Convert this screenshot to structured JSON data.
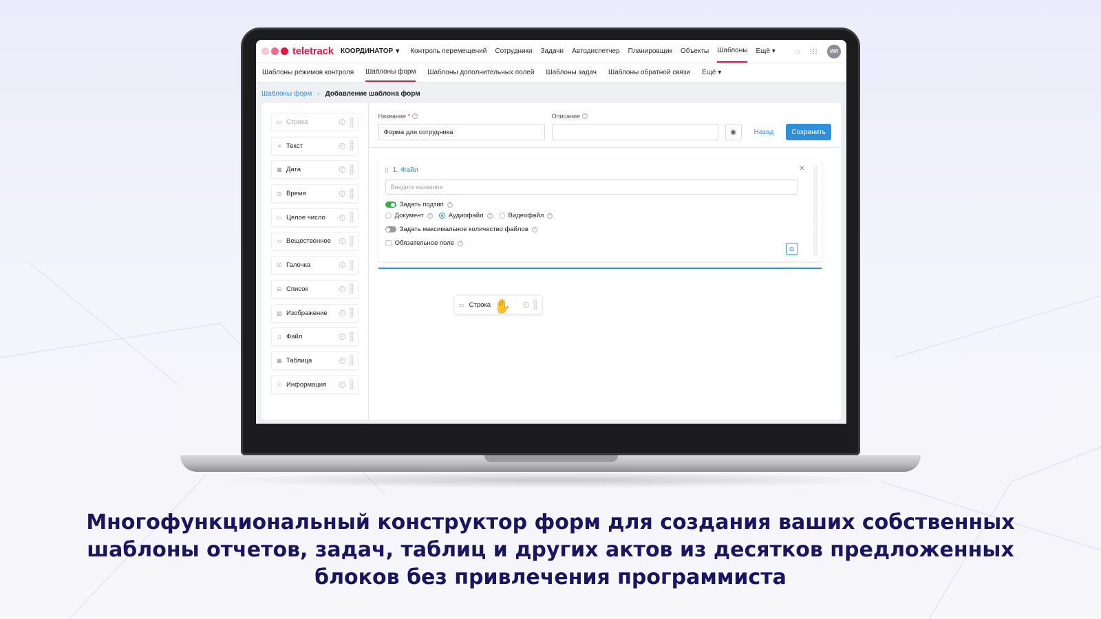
{
  "app": {
    "brand": "teletrack",
    "coordinator": "КООРДИНАТОР",
    "nav": [
      "Контроль перемещений",
      "Сотрудники",
      "Задачи",
      "Автодиспетчер",
      "Планировщик",
      "Объекты",
      "Шаблоны",
      "Ещё"
    ],
    "nav_active": "Шаблоны",
    "avatar": "ИИ",
    "colors": {
      "brand": "#e0193f",
      "accent": "#2f8fdc",
      "toggle_on": "#2fb34a"
    }
  },
  "subnav": [
    "Шаблоны режимов контроля",
    "Шаблоны форм",
    "Шаблоны дополнительных полей",
    "Шаблоны задач",
    "Шаблоны обратной связи",
    "Ещё"
  ],
  "breadcrumb": {
    "link": "Шаблоны форм",
    "current": "Добавление шаблона форм"
  },
  "palette": [
    {
      "label": "Строка",
      "icon": "string-icon"
    },
    {
      "label": "Текст",
      "icon": "text-icon"
    },
    {
      "label": "Дата",
      "icon": "calendar-icon"
    },
    {
      "label": "Время",
      "icon": "clock-icon"
    },
    {
      "label": "Целое число",
      "icon": "integer-icon"
    },
    {
      "label": "Вещественное",
      "icon": "decimal-icon"
    },
    {
      "label": "Галочка",
      "icon": "checkbox-icon"
    },
    {
      "label": "Список",
      "icon": "list-icon"
    },
    {
      "label": "Изображение",
      "icon": "image-icon"
    },
    {
      "label": "Файл",
      "icon": "file-icon"
    },
    {
      "label": "Таблица",
      "icon": "table-icon"
    },
    {
      "label": "Информация",
      "icon": "info-icon"
    }
  ],
  "form": {
    "name_label": "Название",
    "name_required": "*",
    "name_value": "Форма для сотрудника",
    "desc_label": "Описание",
    "desc_value": "",
    "back": "Назад",
    "save": "Сохранить"
  },
  "file_block": {
    "title": "1. Файл",
    "placeholder": "Введите название",
    "subtype_label": "Задать подтип",
    "subtype_on": true,
    "options": [
      "Документ",
      "Аудиофайл",
      "Видеофайл"
    ],
    "selected_option": "Аудиофайл",
    "max_files_label": "Задать максимальное количество файлов",
    "max_files_on": false,
    "required_label": "Обязательное поле"
  },
  "dragging": {
    "label": "Строка"
  },
  "caption": "Многофункциональный конструктор форм для создания ваших собственных шаблоны отчетов, задач, таблиц и других актов из десятков предложенных блоков без привлечения программиста"
}
